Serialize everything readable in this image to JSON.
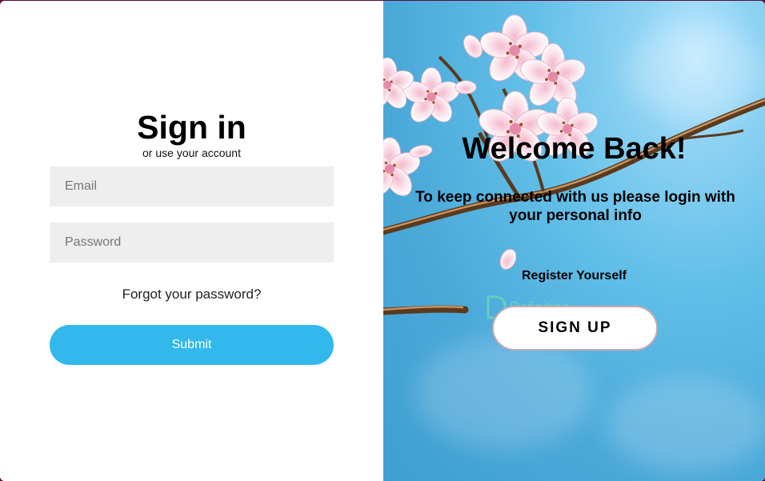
{
  "signin": {
    "title": "Sign in",
    "subtitle": "or use your account",
    "email_placeholder": "Email",
    "password_placeholder": "Password",
    "forgot_label": "Forgot your password?",
    "submit_label": "Submit"
  },
  "welcome": {
    "title": "Welcome Back!",
    "message": "To keep connected with us please login with your personal info",
    "register_label": "Register Yourself",
    "signup_label": "SIGN UP",
    "watermark_text": "Definition"
  },
  "colors": {
    "submit": "#33b8ec",
    "sky": "#4aa8d9",
    "input_bg": "#eeeeee"
  },
  "icons": [
    "cherry-blossom-branch",
    "watermark-logo-icon"
  ]
}
